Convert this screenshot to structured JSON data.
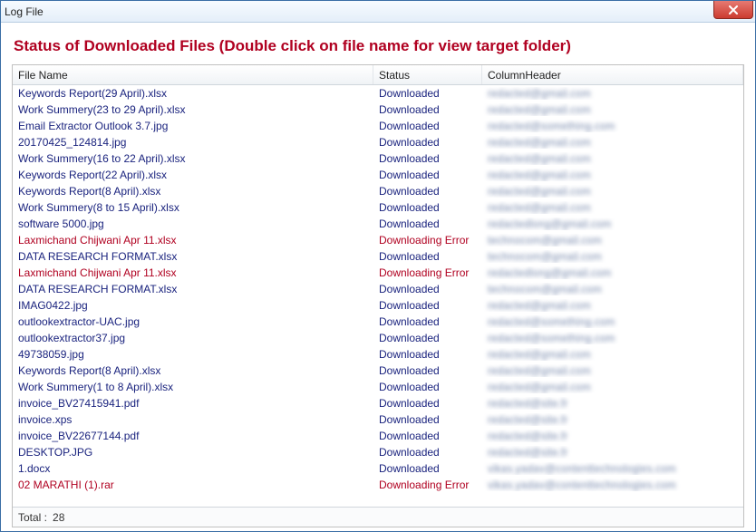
{
  "window": {
    "title": "Log File"
  },
  "heading": "Status of Downloaded Files (Double click on file name for view target folder)",
  "columns": {
    "file": "File Name",
    "status": "Status",
    "extra": "ColumnHeader"
  },
  "status_labels": {
    "ok": "Downloaded",
    "err": "Downloading Error"
  },
  "rows": [
    {
      "file": "Keywords Report(29 April).xlsx",
      "status": "ok",
      "extra": "redacted@gmail.com"
    },
    {
      "file": "Work Summery(23 to 29 April).xlsx",
      "status": "ok",
      "extra": "redacted@gmail.com"
    },
    {
      "file": "Email Extractor Outlook 3.7.jpg",
      "status": "ok",
      "extra": "redacted@something.com"
    },
    {
      "file": "20170425_124814.jpg",
      "status": "ok",
      "extra": "redacted@gmail.com"
    },
    {
      "file": "Work Summery(16 to 22 April).xlsx",
      "status": "ok",
      "extra": "redacted@gmail.com"
    },
    {
      "file": "Keywords Report(22 April).xlsx",
      "status": "ok",
      "extra": "redacted@gmail.com"
    },
    {
      "file": "Keywords Report(8 April).xlsx",
      "status": "ok",
      "extra": "redacted@gmail.com"
    },
    {
      "file": "Work Summery(8 to 15 April).xlsx",
      "status": "ok",
      "extra": "redacted@gmail.com"
    },
    {
      "file": "software 5000.jpg",
      "status": "ok",
      "extra": "redactedlong@gmail.com"
    },
    {
      "file": "Laxmichand Chijwani Apr 11.xlsx",
      "status": "err",
      "extra": "technocom@gmail.com"
    },
    {
      "file": "DATA RESEARCH FORMAT.xlsx",
      "status": "ok",
      "extra": "technocom@gmail.com"
    },
    {
      "file": "Laxmichand Chijwani Apr 11.xlsx",
      "status": "err",
      "extra": "redactedlong@gmail.com"
    },
    {
      "file": "DATA RESEARCH FORMAT.xlsx",
      "status": "ok",
      "extra": "technocom@gmail.com"
    },
    {
      "file": "IMAG0422.jpg",
      "status": "ok",
      "extra": "redacted@gmail.com"
    },
    {
      "file": "outlookextractor-UAC.jpg",
      "status": "ok",
      "extra": "redacted@something.com"
    },
    {
      "file": "outlookextractor37.jpg",
      "status": "ok",
      "extra": "redacted@something.com"
    },
    {
      "file": "49738059.jpg",
      "status": "ok",
      "extra": "redacted@gmail.com"
    },
    {
      "file": "Keywords Report(8 April).xlsx",
      "status": "ok",
      "extra": "redacted@gmail.com"
    },
    {
      "file": "Work Summery(1 to 8 April).xlsx",
      "status": "ok",
      "extra": "redacted@gmail.com"
    },
    {
      "file": "invoice_BV27415941.pdf",
      "status": "ok",
      "extra": "redacted@site.fr"
    },
    {
      "file": "invoice.xps",
      "status": "ok",
      "extra": "redacted@site.fr"
    },
    {
      "file": "invoice_BV22677144.pdf",
      "status": "ok",
      "extra": "redacted@site.fr"
    },
    {
      "file": "DESKTOP.JPG",
      "status": "ok",
      "extra": "redacted@site.fr"
    },
    {
      "file": "1.docx",
      "status": "ok",
      "extra": "vikas.yadav@contenttechnologies.com"
    },
    {
      "file": "02 MARATHI (1).rar",
      "status": "err",
      "extra": "vikas.yadav@contenttechnologies.com"
    }
  ],
  "footer": {
    "label": "Total :",
    "count": "28"
  }
}
